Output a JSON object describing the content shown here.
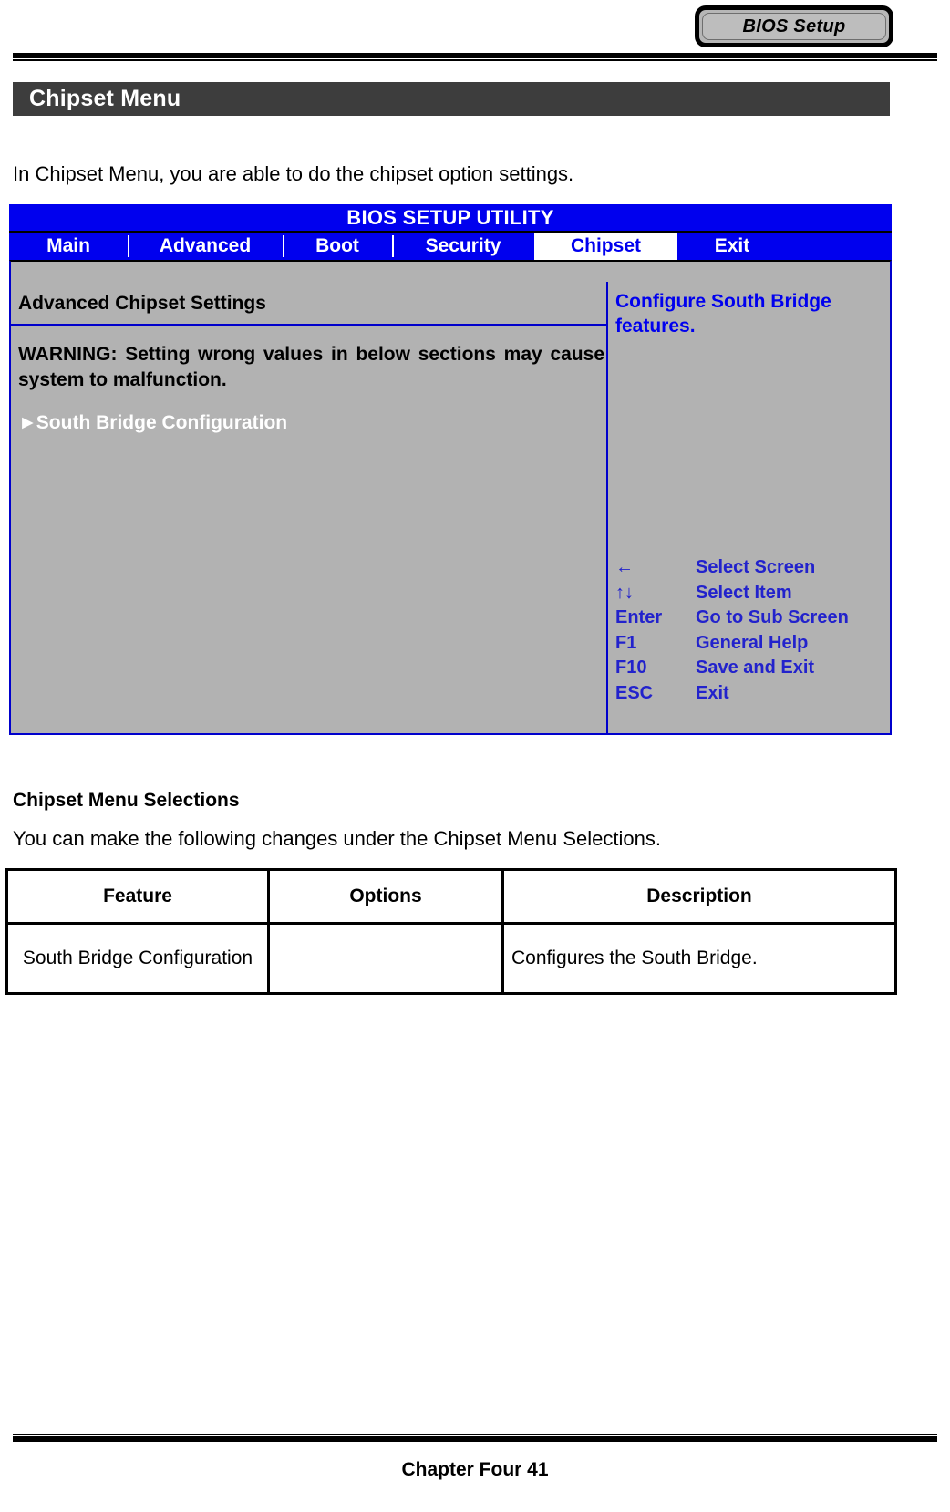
{
  "header": {
    "badge_label": "BIOS Setup",
    "section_title": "Chipset Menu"
  },
  "intro": {
    "paragraph": "In Chipset Menu, you are able to do the chipset option settings."
  },
  "bios": {
    "title": "BIOS SETUP UTILITY",
    "tabs": [
      {
        "label": "Main",
        "selected": false
      },
      {
        "label": "Advanced",
        "selected": false
      },
      {
        "label": "Boot",
        "selected": false
      },
      {
        "label": "Security",
        "selected": false
      },
      {
        "label": "Chipset",
        "selected": true
      },
      {
        "label": "Exit",
        "selected": false
      }
    ],
    "left": {
      "heading": "Advanced Chipset Settings",
      "warning": "WARNING: Setting wrong values in below sections may cause system to malfunction.",
      "menu_item_caret": "►",
      "menu_item_label": "South Bridge Configuration"
    },
    "right": {
      "help_text": "Configure South Bridge features.",
      "keys": [
        {
          "key": "←",
          "desc": "Select Screen"
        },
        {
          "key": "↑↓",
          "desc": "Select Item"
        },
        {
          "key": "Enter",
          "desc": "Go to Sub Screen"
        },
        {
          "key": "F1",
          "desc": "General Help"
        },
        {
          "key": "F10",
          "desc": "Save and Exit"
        },
        {
          "key": "ESC",
          "desc": "Exit"
        }
      ]
    },
    "colors": {
      "title_bg": "#0000ee",
      "panel_bg": "#b2b2b2",
      "border": "#0000cc",
      "help_text": "#0000ee"
    }
  },
  "selections": {
    "heading": "Chipset Menu Selections",
    "paragraph": "You can make the following changes under the Chipset Menu Selections.",
    "table": {
      "headers": [
        "Feature",
        "Options",
        "Description"
      ],
      "rows": [
        {
          "feature": "South Bridge Configuration",
          "options": "",
          "description": "Configures the South Bridge."
        }
      ]
    }
  },
  "footer": {
    "text": "Chapter Four 41"
  }
}
